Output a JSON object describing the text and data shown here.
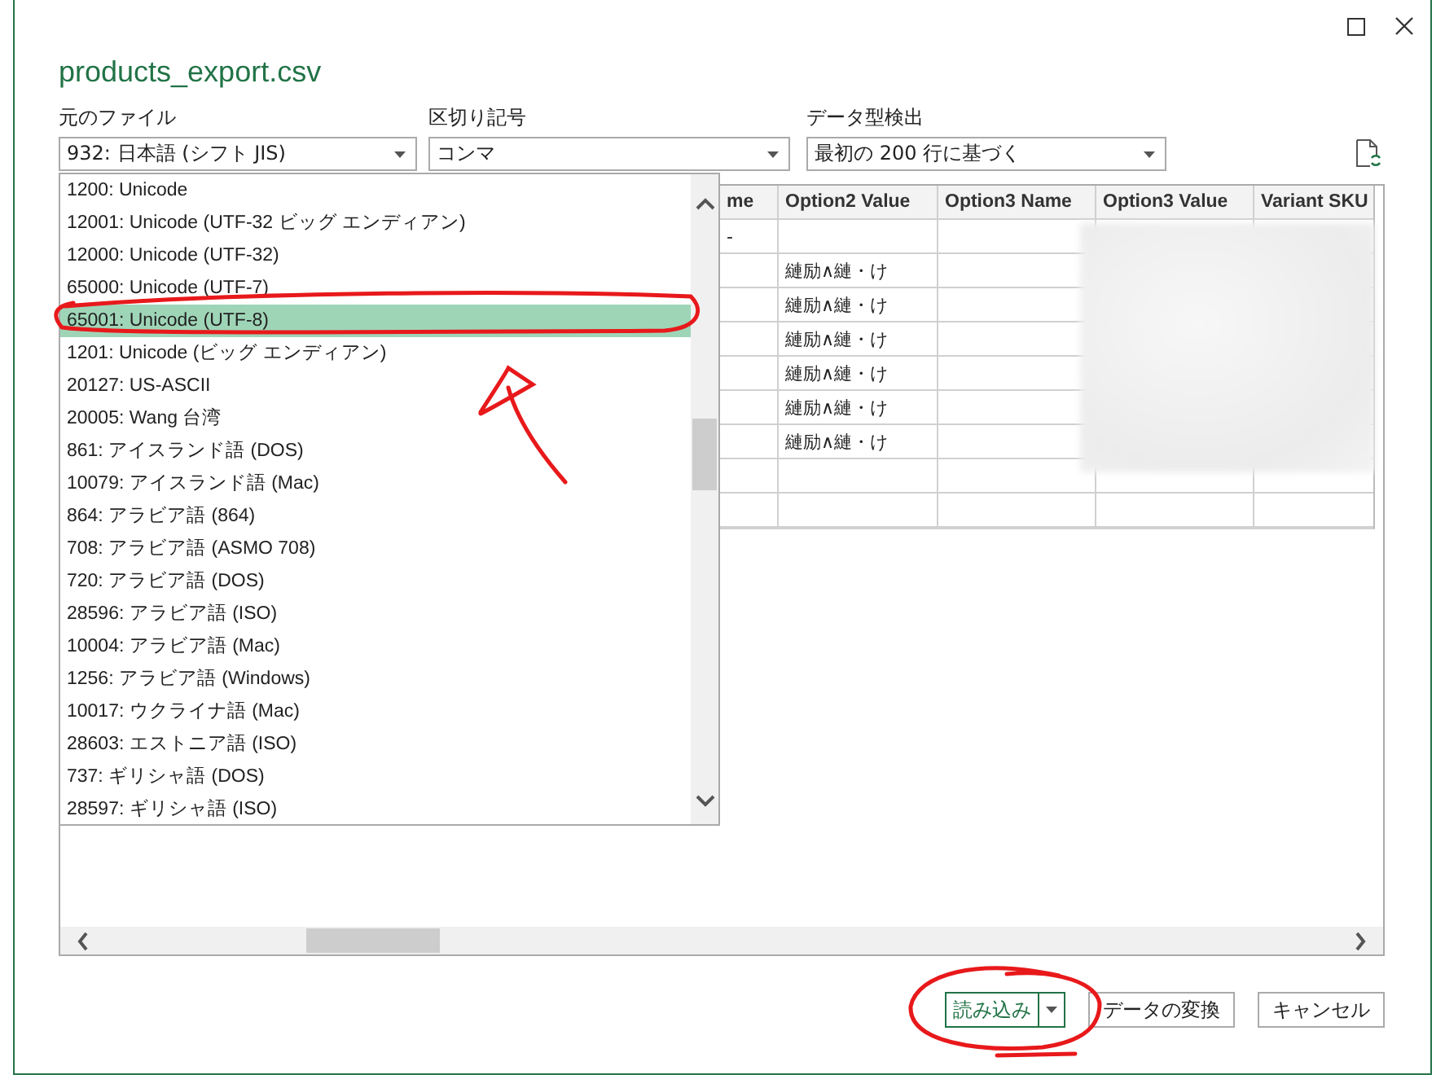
{
  "dialog": {
    "title": "products_export.csv"
  },
  "fields": [
    {
      "label": "元のファイル",
      "value": "932: 日本語 (シフト JIS)"
    },
    {
      "label": "区切り記号",
      "value": "コンマ"
    },
    {
      "label": "データ型検出",
      "value": "最初の 200 行に基づく"
    }
  ],
  "encoding_list": {
    "items": [
      {
        "label": "1200: Unicode",
        "selected": false
      },
      {
        "label": "12001: Unicode (UTF-32 ビッグ エンディアン)",
        "selected": false
      },
      {
        "label": "12000: Unicode (UTF-32)",
        "selected": false
      },
      {
        "label": "65000: Unicode (UTF-7)",
        "selected": false
      },
      {
        "label": "65001: Unicode (UTF-8)",
        "selected": true
      },
      {
        "label": "1201: Unicode (ビッグ エンディアン)",
        "selected": false
      },
      {
        "label": "20127: US-ASCII",
        "selected": false
      },
      {
        "label": "20005: Wang 台湾",
        "selected": false
      },
      {
        "label": "861: アイスランド語 (DOS)",
        "selected": false
      },
      {
        "label": "10079: アイスランド語 (Mac)",
        "selected": false
      },
      {
        "label": "864: アラビア語 (864)",
        "selected": false
      },
      {
        "label": "708: アラビア語 (ASMO 708)",
        "selected": false
      },
      {
        "label": "720: アラビア語 (DOS)",
        "selected": false
      },
      {
        "label": "28596: アラビア語 (ISO)",
        "selected": false
      },
      {
        "label": "10004: アラビア語 (Mac)",
        "selected": false
      },
      {
        "label": "1256: アラビア語 (Windows)",
        "selected": false
      },
      {
        "label": "10017: ウクライナ語 (Mac)",
        "selected": false
      },
      {
        "label": "28603: エストニア語 (ISO)",
        "selected": false
      },
      {
        "label": "737: ギリシャ語 (DOS)",
        "selected": false
      },
      {
        "label": "28597: ギリシャ語 (ISO)",
        "selected": false
      }
    ]
  },
  "preview_table": {
    "columns": [
      "me",
      "Option2 Value",
      "Option3 Name",
      "Option3 Value",
      "Variant SKU"
    ],
    "rows": [
      {
        "column_1": "-"
      },
      {
        "option2_value": "縺励∧縺・け"
      },
      {
        "option2_value": "縺励∧縺・け"
      },
      {
        "option2_value": "縺励∧縺・け"
      },
      {
        "option2_value": "縺励∧縺・け"
      },
      {
        "option2_value": "縺励∧縺・け"
      },
      {
        "option2_value": "縺励∧縺・け"
      },
      {},
      {}
    ]
  },
  "buttons": [
    {
      "label": "読み込み",
      "kind": "split"
    },
    {
      "label": "データの変換",
      "kind": "plain"
    },
    {
      "label": "キャンセル",
      "kind": "plain"
    }
  ]
}
